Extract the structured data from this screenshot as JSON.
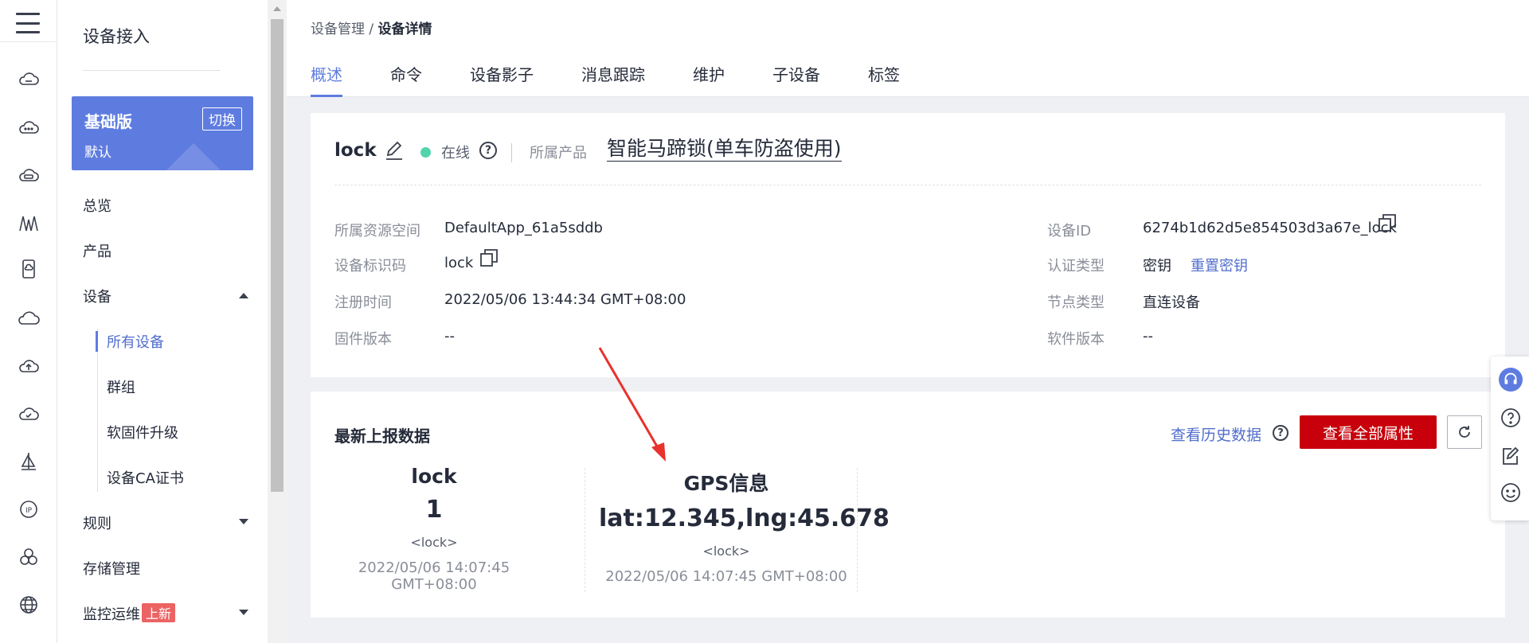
{
  "nav": {
    "title": "设备接入",
    "edition": {
      "name": "基础版",
      "sub": "默认",
      "switch": "切换"
    },
    "items": {
      "overview": "总览",
      "product": "产品",
      "device": "设备",
      "all_devices": "所有设备",
      "group": "群组",
      "firmware": "软固件升级",
      "ca": "设备CA证书",
      "rules": "规则",
      "storage": "存储管理",
      "monitor": "监控运维",
      "monitor_badge": "上新"
    }
  },
  "breadcrumb": {
    "parent": "设备管理",
    "separator": " / ",
    "current": "设备详情"
  },
  "tabs": [
    "概述",
    "命令",
    "设备影子",
    "消息跟踪",
    "维护",
    "子设备",
    "标签"
  ],
  "device": {
    "name": "lock",
    "status": "在线",
    "product_label": "所属产品",
    "product_name": "智能马蹄锁(单车防盗使用)",
    "fields_left": [
      {
        "label": "所属资源空间",
        "value": "DefaultApp_61a5sddb"
      },
      {
        "label": "设备标识码",
        "value": "lock"
      },
      {
        "label": "注册时间",
        "value": "2022/05/06 13:44:34 GMT+08:00"
      },
      {
        "label": "固件版本",
        "value": "--"
      }
    ],
    "fields_right": [
      {
        "label": "设备ID",
        "value": "6274b1d62d5e854503d3a67e_lock"
      },
      {
        "label": "认证类型",
        "value": "密钥",
        "link": "重置密钥"
      },
      {
        "label": "节点类型",
        "value": "直连设备"
      },
      {
        "label": "软件版本",
        "value": "--"
      }
    ]
  },
  "latest": {
    "title": "最新上报数据",
    "history_link": "查看历史数据",
    "view_all_button": "查看全部属性",
    "properties": [
      {
        "name": "lock",
        "value": "1",
        "tag": "<lock>",
        "time": "2022/05/06 14:07:45 GMT+08:00"
      },
      {
        "name": "GPS信息",
        "value": "lat:12.345,lng:45.678",
        "tag": "<lock>",
        "time": "2022/05/06 14:07:45 GMT+08:00"
      }
    ]
  },
  "colors": {
    "accent": "#5e7ce0",
    "danger": "#c7000b",
    "online": "#50d4ab",
    "arrow": "#e8322d"
  },
  "icons": {
    "rail": [
      "menu-icon",
      "cloud-icon",
      "cloud-dots-icon",
      "cloud-db-icon",
      "antenna-icon",
      "phone-cloud-icon",
      "cloud-outline-icon",
      "cloud-upload-icon",
      "cloud-check-icon",
      "sailboat-icon",
      "ip-icon",
      "cluster-icon",
      "globe-icon"
    ],
    "float": [
      "headset-icon",
      "question-icon",
      "note-edit-icon",
      "smile-icon"
    ]
  }
}
